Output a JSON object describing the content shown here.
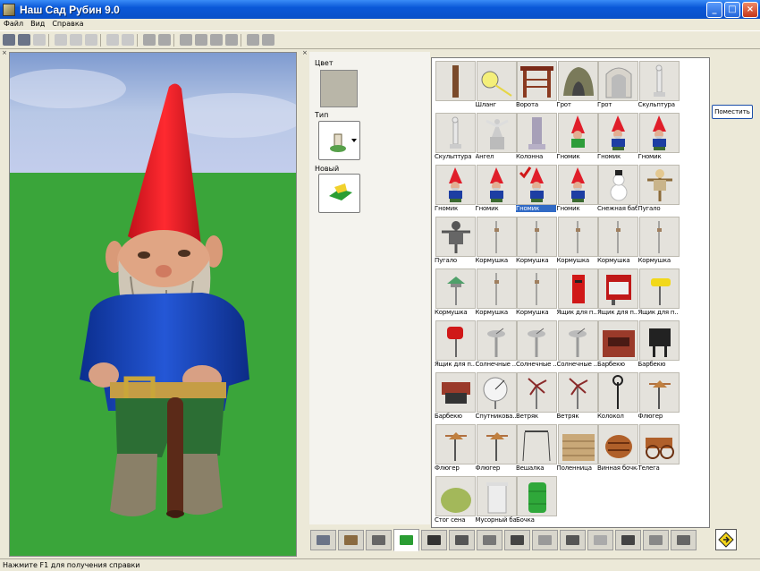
{
  "window": {
    "title": "Наш Сад Рубин 9.0"
  },
  "menu": [
    "Файл",
    "Вид",
    "Справка"
  ],
  "panel": {
    "color_label": "Цвет",
    "type_label": "Тип",
    "new_label": "Новый",
    "swatch_color": "#b9b6a8"
  },
  "place_button": "Поместить",
  "catalog": [
    {
      "label": "",
      "icon": "post"
    },
    {
      "label": "Шланг",
      "icon": "hose"
    },
    {
      "label": "Ворота",
      "icon": "gate"
    },
    {
      "label": "Грот",
      "icon": "grotto-stone"
    },
    {
      "label": "Грот",
      "icon": "grotto-arch"
    },
    {
      "label": "Скульптура",
      "icon": "sculpture"
    },
    {
      "label": "Скульптура",
      "icon": "sculpture"
    },
    {
      "label": "Ангел",
      "icon": "angel"
    },
    {
      "label": "Колонна",
      "icon": "column"
    },
    {
      "label": "Гномик",
      "icon": "gnome-green"
    },
    {
      "label": "Гномик",
      "icon": "gnome"
    },
    {
      "label": "Гномик",
      "icon": "gnome"
    },
    {
      "label": "Гномик",
      "icon": "gnome"
    },
    {
      "label": "Гномик",
      "icon": "gnome"
    },
    {
      "label": "Гномик",
      "icon": "gnome",
      "selected": true,
      "check": true
    },
    {
      "label": "Гномик",
      "icon": "gnome"
    },
    {
      "label": "Снежная баба",
      "icon": "snowman"
    },
    {
      "label": "Пугало",
      "icon": "scarecrow"
    },
    {
      "label": "Пугало",
      "icon": "scarecrow-dark"
    },
    {
      "label": "Кормушка",
      "icon": "feeder"
    },
    {
      "label": "Кормушка",
      "icon": "feeder"
    },
    {
      "label": "Кормушка",
      "icon": "feeder"
    },
    {
      "label": "Кормушка",
      "icon": "feeder"
    },
    {
      "label": "Кормушка",
      "icon": "feeder"
    },
    {
      "label": "Кормушка",
      "icon": "feeder-green"
    },
    {
      "label": "Кормушка",
      "icon": "feeder"
    },
    {
      "label": "Кормушка",
      "icon": "feeder"
    },
    {
      "label": "Ящик для п...",
      "icon": "mailbox-red"
    },
    {
      "label": "Ящик для п...",
      "icon": "mailbox-red-big"
    },
    {
      "label": "Ящик для п...",
      "icon": "mailbox-yellow"
    },
    {
      "label": "Ящик для п...",
      "icon": "mailbox-red-post"
    },
    {
      "label": "Солнечные ...",
      "icon": "sundial"
    },
    {
      "label": "Солнечные ...",
      "icon": "sundial"
    },
    {
      "label": "Солнечные ...",
      "icon": "sundial"
    },
    {
      "label": "Барбекю",
      "icon": "bbq-brick"
    },
    {
      "label": "Барбекю",
      "icon": "bbq-black"
    },
    {
      "label": "Барбекю",
      "icon": "bbq-grill"
    },
    {
      "label": "Спутникова...",
      "icon": "satellite"
    },
    {
      "label": "Ветряк",
      "icon": "windmill"
    },
    {
      "label": "Ветряк",
      "icon": "windmill"
    },
    {
      "label": "Колокол",
      "icon": "bell"
    },
    {
      "label": "Флюгер",
      "icon": "vane"
    },
    {
      "label": "Флюгер",
      "icon": "vane"
    },
    {
      "label": "Флюгер",
      "icon": "vane"
    },
    {
      "label": "Вешалка",
      "icon": "clothesline"
    },
    {
      "label": "Поленница",
      "icon": "woodpile"
    },
    {
      "label": "Винная бочка",
      "icon": "barrel"
    },
    {
      "label": "Телега",
      "icon": "cart"
    },
    {
      "label": "Стог сена",
      "icon": "haystack"
    },
    {
      "label": "Мусорный бак",
      "icon": "trash-bin"
    },
    {
      "label": "Бочка",
      "icon": "green-barrel"
    }
  ],
  "bottom_tabs": [
    "terrain",
    "house",
    "deck",
    "decor",
    "flowers",
    "trees",
    "path",
    "fence",
    "wall",
    "floor",
    "books",
    "tools",
    "bridge",
    "brick"
  ],
  "status": "Нажмите F1 для получения справки"
}
